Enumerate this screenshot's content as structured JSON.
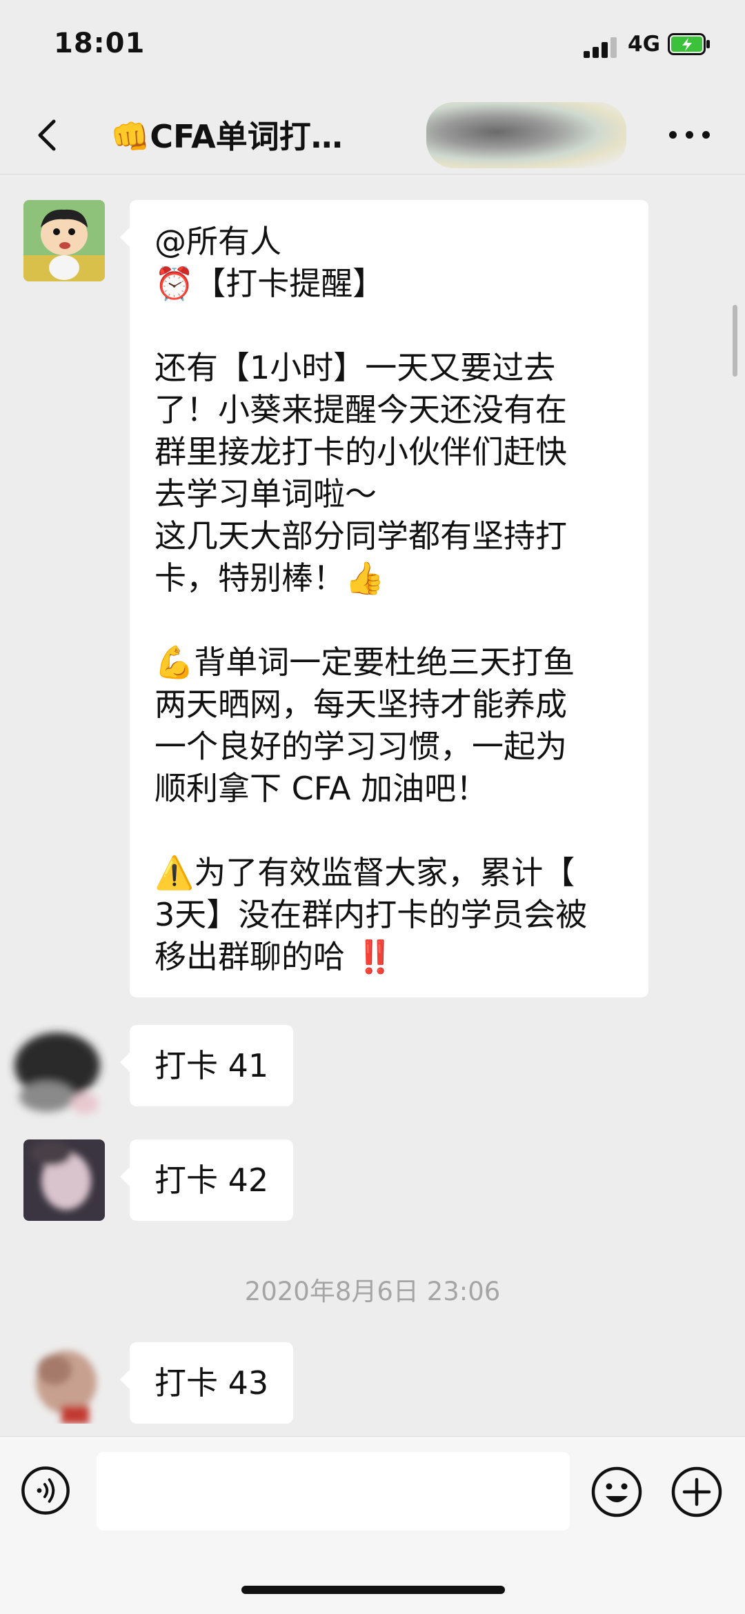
{
  "status_bar": {
    "time": "18:01",
    "network": "4G"
  },
  "header": {
    "title": "👊CFA单词打…",
    "title_suffix": "（"
  },
  "messages": {
    "main": {
      "lines": [
        "@所有人",
        "⏰【打卡提醒】",
        "",
        "还有【1小时】一天又要过去",
        "了！小葵来提醒今天还没有在",
        "群里接龙打卡的小伙伴们赶快",
        "去学习单词啦～",
        "这几天大部分同学都有坚持打",
        "卡，特别棒！👍",
        "",
        "💪背单词一定要杜绝三天打鱼",
        "两天晒网，每天坚持才能养成",
        "一个良好的学习习惯，一起为",
        "顺利拿下 CFA 加油吧！",
        "",
        "⚠️为了有效监督大家，累计【",
        "3天】没在群内打卡的学员会被",
        "移出群聊的哈 ‼️"
      ]
    },
    "checkin_41": "打卡 41",
    "checkin_42": "打卡 42",
    "timestamp": "2020年8月6日 23:06",
    "checkin_43": "打卡 43"
  },
  "input": {
    "placeholder": ""
  },
  "colors": {
    "background": "#ededed",
    "bubble": "#ffffff",
    "timestamp": "#a5a5a5",
    "battery": "#3cc13b"
  }
}
